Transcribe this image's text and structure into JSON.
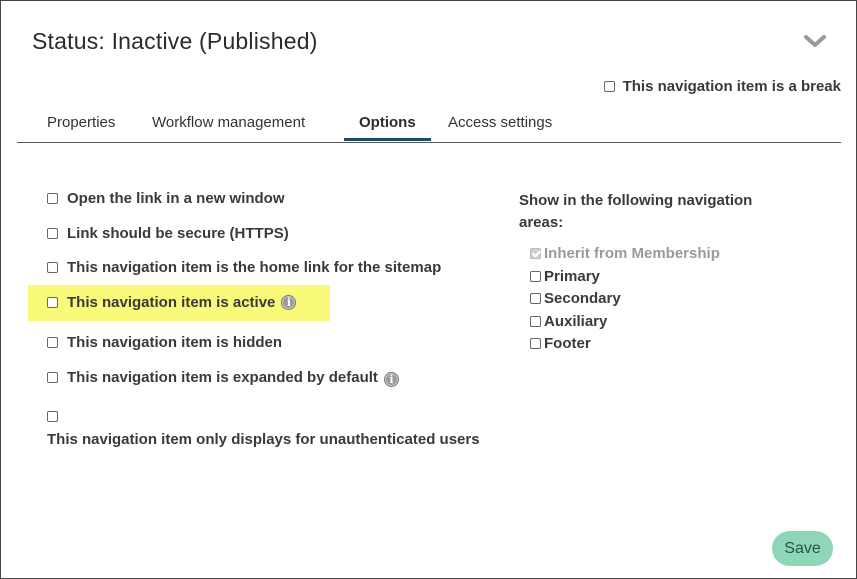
{
  "header": {
    "title": "Status: Inactive (Published)",
    "collapse_icon": "chevron-down-icon",
    "break_label": "This navigation item is a break"
  },
  "tabs": [
    {
      "label": "Properties",
      "active": false
    },
    {
      "label": "Workflow management",
      "active": false
    },
    {
      "label": "Options",
      "active": true
    },
    {
      "label": "Access settings",
      "active": false
    }
  ],
  "options": [
    {
      "label": "Open the link in a new window",
      "checked": false
    },
    {
      "label": "Link should be secure (HTTPS)",
      "checked": false
    },
    {
      "label": "This navigation item is the home link for the sitemap",
      "checked": false
    },
    {
      "label": "This navigation item is active",
      "checked": false,
      "info": true,
      "highlighted": true
    },
    {
      "label": "This navigation item is hidden",
      "checked": false
    },
    {
      "label": "This navigation item is expanded by default",
      "checked": false,
      "info": true
    },
    {
      "label": "This navigation item only displays for unauthenticated users",
      "checked": false
    }
  ],
  "nav_areas": {
    "heading": "Show in the following navigation areas:",
    "items": [
      {
        "label": "Inherit from Membership",
        "checked": true,
        "disabled": true
      },
      {
        "label": "Primary",
        "checked": false
      },
      {
        "label": "Secondary",
        "checked": false
      },
      {
        "label": "Auxiliary",
        "checked": false
      },
      {
        "label": "Footer",
        "checked": false
      }
    ]
  },
  "info_icon_glyph": "i",
  "highlight_color": "#fafa7a",
  "save_label": "Save",
  "colors": {
    "save_bg": "#8fd6b8",
    "tab_underline": "#1e4d6b"
  }
}
